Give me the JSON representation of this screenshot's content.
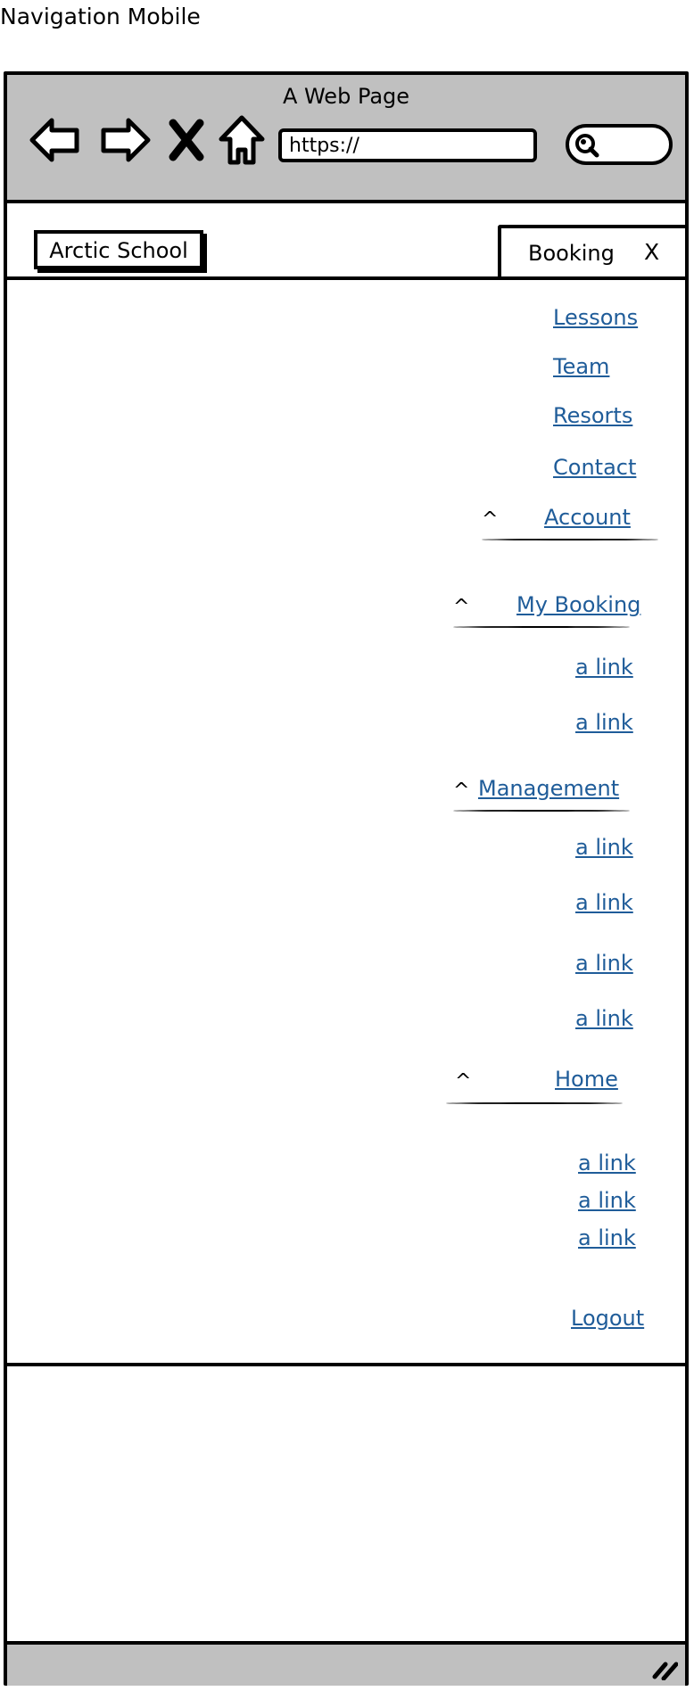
{
  "page_label": "Navigation Mobile",
  "browser": {
    "title": "A Web Page",
    "url": "https://",
    "nav_icons": [
      "back-arrow-icon",
      "forward-arrow-icon",
      "stop-icon",
      "home-icon"
    ],
    "search_icon": "magnifier-icon"
  },
  "header": {
    "brand": "Arctic School",
    "booking_label": "Booking",
    "close_label": "X"
  },
  "menu": {
    "top_links": [
      "Lessons",
      "Team",
      "Resorts",
      "Contact"
    ],
    "caret": "^",
    "account": {
      "label": "Account"
    },
    "my_booking": {
      "label": "My Booking",
      "links": [
        "a link",
        "a link"
      ]
    },
    "management": {
      "label": "Management",
      "links": [
        "a link",
        "a link",
        "a link",
        "a link"
      ]
    },
    "home": {
      "label": "Home",
      "links": [
        "a link",
        "a link",
        "a link"
      ]
    },
    "logout": "Logout"
  },
  "colors": {
    "link": "#1f5c99",
    "chrome": "#c0c0c0"
  }
}
